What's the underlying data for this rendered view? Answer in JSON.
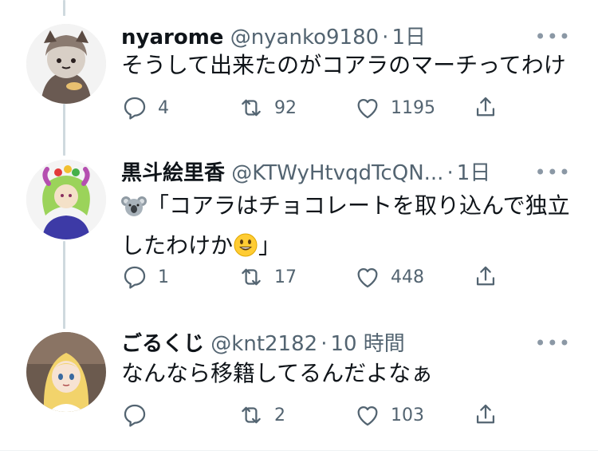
{
  "tweets": [
    {
      "name": "nyarome",
      "handle": "@nyanko9180",
      "separator": "·",
      "time": "1日",
      "text": "そうして出来たのがコアラのマーチってわけ",
      "replies": "4",
      "retweets": "92",
      "likes": "1195",
      "more": "•••"
    },
    {
      "name": "黒斗絵里香",
      "handle": "@KTWyHtvqdTcQN...",
      "separator": "·",
      "time": "1日",
      "text_line1": "「コアラはチョコレートを取り込んで独立",
      "text_line2_a": "したわけか",
      "text_line2_b": "」",
      "replies": "1",
      "retweets": "17",
      "likes": "448",
      "more": "•••"
    },
    {
      "name": "ごるくじ",
      "handle": "@knt2182",
      "separator": "·",
      "time": "10 時間",
      "text": "なんなら移籍してるんだよなぁ",
      "replies": "",
      "retweets": "2",
      "likes": "103",
      "more": "•••"
    }
  ],
  "icons": {
    "reply": "reply-icon",
    "retweet": "retweet-icon",
    "like": "like-icon",
    "share": "share-icon",
    "koala_emoji": "koala-emoji",
    "smile_emoji": "smiling-face-emoji"
  },
  "colors": {
    "primary_text": "#0f1419",
    "secondary_text": "#536471",
    "thread_line": "#cfd9de"
  }
}
